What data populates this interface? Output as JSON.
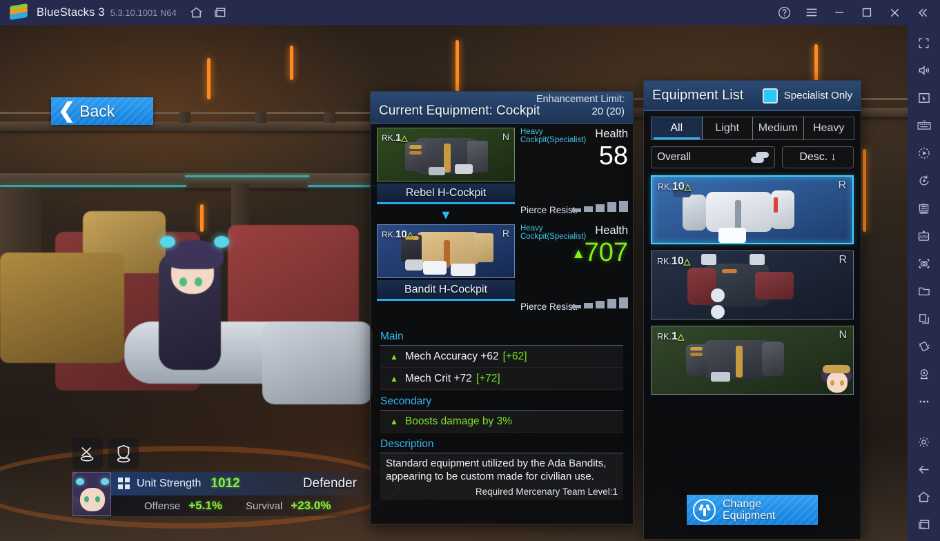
{
  "window": {
    "app_name": "BlueStacks 3",
    "version": "5.3.10.1001 N64",
    "controls": {
      "help": "?",
      "menu": "menu-icon",
      "minimize": "minimize-icon",
      "maximize": "maximize-icon",
      "close": "close-icon",
      "collapse": "collapse-icon"
    },
    "nav": {
      "home": "home-icon",
      "recents": "recents-icon"
    }
  },
  "sidebar": {
    "items": [
      {
        "name": "fullscreen-icon"
      },
      {
        "name": "volume-icon"
      },
      {
        "name": "cursor-icon"
      },
      {
        "name": "keyboard-controls-icon"
      },
      {
        "name": "macro-record-icon"
      },
      {
        "name": "rotate-icon"
      },
      {
        "name": "multi-instance-icon"
      },
      {
        "name": "install-apk-icon"
      },
      {
        "name": "screenshot-icon"
      },
      {
        "name": "media-folder-icon"
      },
      {
        "name": "copy-paste-icon"
      },
      {
        "name": "shake-icon"
      },
      {
        "name": "location-icon"
      },
      {
        "name": "more-icon"
      },
      {
        "name": "settings-icon"
      },
      {
        "name": "back-icon"
      },
      {
        "name": "home-icon"
      },
      {
        "name": "recents-icon"
      }
    ]
  },
  "game": {
    "back_button": "Back",
    "unit": {
      "strength_label": "Unit Strength",
      "strength_value": "1012",
      "role": "Defender",
      "offense_label": "Offense",
      "offense_value": "+5.1%",
      "survival_label": "Survival",
      "survival_value": "+23.0%"
    },
    "role_icons": [
      "attack-role-icon",
      "defense-role-icon"
    ]
  },
  "equipment_panel": {
    "title": "Current Equipment: Cockpit",
    "limit_label": "Enhancement Limit:",
    "limit_value": "20 (20)",
    "current": {
      "rank_prefix": "RK.",
      "rank": "1",
      "grade": "N",
      "name": "Rebel H-Cockpit",
      "type": "Heavy Cockpit(Specialist)",
      "health_label": "Health",
      "health_value": "58",
      "pierce_label": "Pierce Resist.",
      "pierce_bars": [
        5,
        8,
        11,
        14,
        16
      ]
    },
    "replacement": {
      "rank_prefix": "RK.",
      "rank": "10",
      "grade": "R",
      "name": "Bandit H-Cockpit",
      "type": "Heavy Cockpit(Specialist)",
      "health_label": "Health",
      "health_value": "707",
      "health_delta": "▲",
      "pierce_label": "Pierce Resist.",
      "pierce_bars": [
        5,
        8,
        11,
        14,
        16
      ]
    },
    "main": {
      "title": "Main",
      "rows": [
        {
          "text": "Mech Accuracy +62",
          "bonus": "[+62]"
        },
        {
          "text": "Mech Crit +72",
          "bonus": "[+72]"
        }
      ]
    },
    "secondary": {
      "title": "Secondary",
      "rows": [
        {
          "text": "Boosts damage by 3%",
          "bonus": ""
        }
      ]
    },
    "description": {
      "title": "Description",
      "body": "Standard equipment utilized by the Ada Bandits, appearing to be custom made for civilian use.",
      "requirement": "Required Mercenary Team Level:1"
    }
  },
  "equipment_list": {
    "title": "Equipment List",
    "specialist_only_label": "Specialist Only",
    "specialist_only_checked": true,
    "tabs": [
      {
        "label": "All",
        "active": true
      },
      {
        "label": "Light",
        "active": false
      },
      {
        "label": "Medium",
        "active": false
      },
      {
        "label": "Heavy",
        "active": false
      }
    ],
    "filter_overall": "Overall",
    "sort": "Desc. ↓",
    "items": [
      {
        "rank_prefix": "RK.",
        "rank": "10",
        "grade": "R",
        "selected": true,
        "theme": "blue"
      },
      {
        "rank_prefix": "RK.",
        "rank": "10",
        "grade": "R",
        "selected": false,
        "theme": "dark"
      },
      {
        "rank_prefix": "RK.",
        "rank": "1",
        "grade": "N",
        "selected": false,
        "theme": "green"
      }
    ],
    "change_button_line1": "Change",
    "change_button_line2": "Equipment"
  },
  "colors": {
    "accent_blue": "#2fb4ee",
    "accent_green": "#7ee02a",
    "header_blue": "#1d3556",
    "panel_bg": "#080a0e"
  }
}
